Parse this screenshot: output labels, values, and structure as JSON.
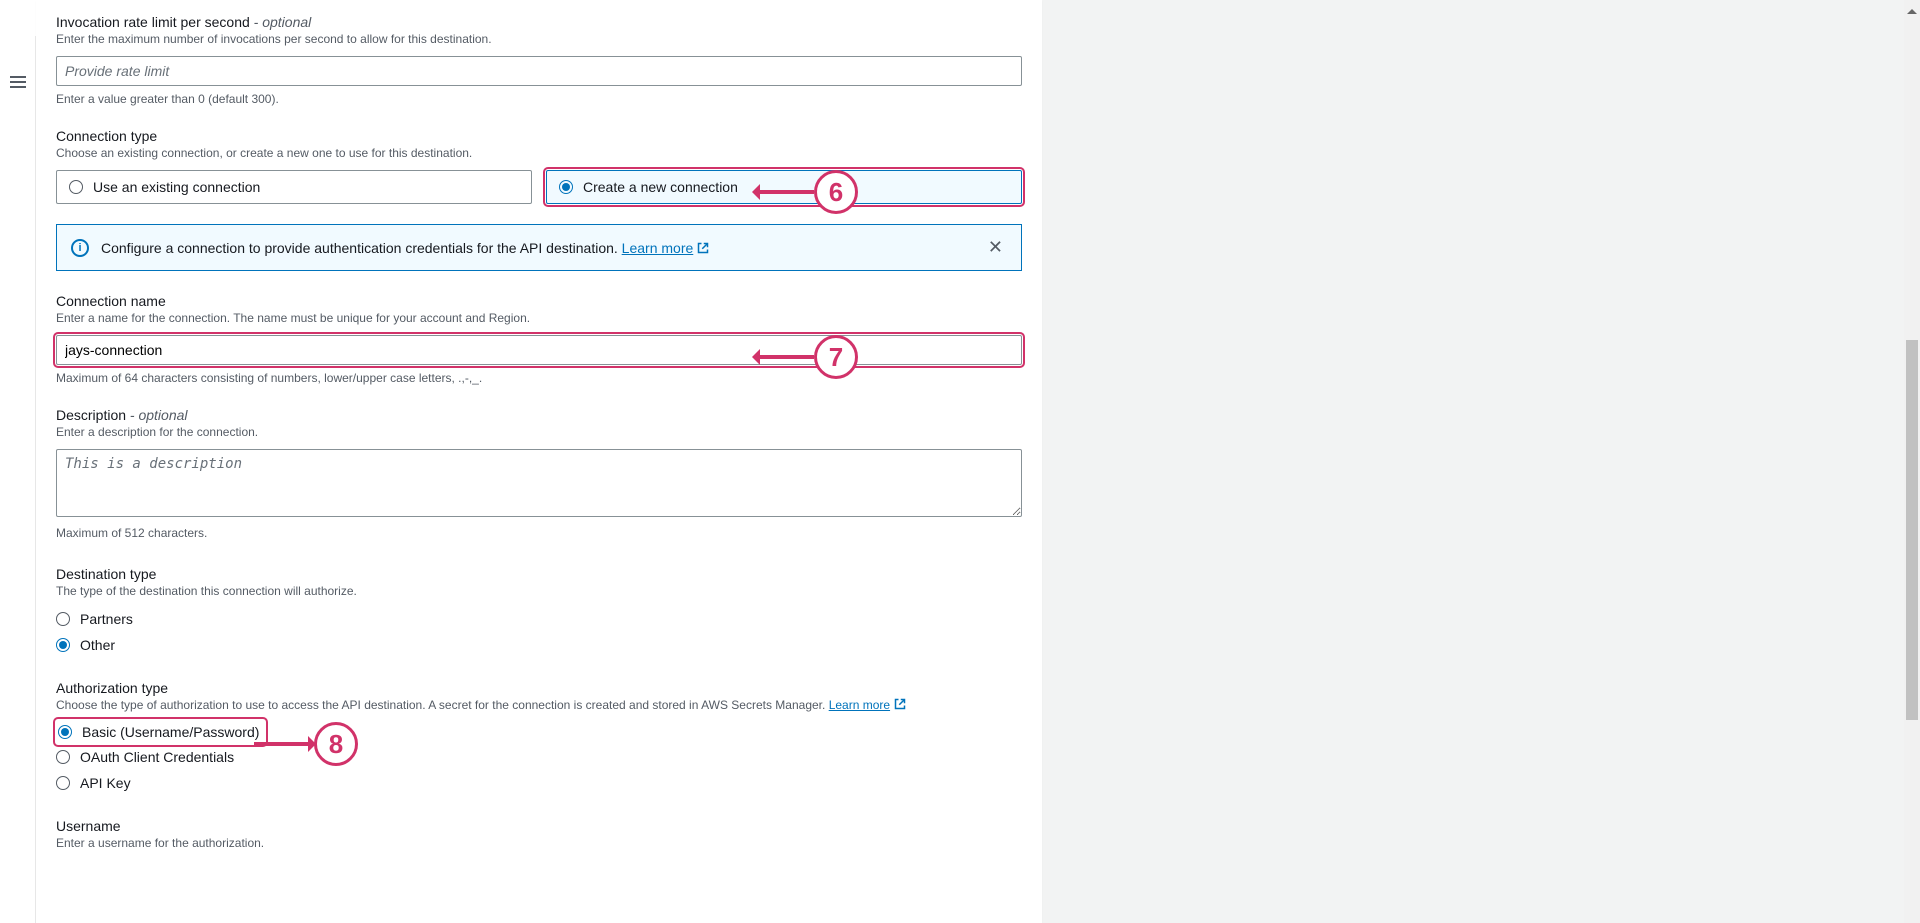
{
  "invocation": {
    "label": "Invocation rate limit per second",
    "optional": " - optional",
    "sub": "Enter the maximum number of invocations per second to allow for this destination.",
    "placeholder": "Provide rate limit",
    "hint": "Enter a value greater than 0 (default 300)."
  },
  "connectionType": {
    "label": "Connection type",
    "sub": "Choose an existing connection, or create a new one to use for this destination.",
    "option_existing": "Use an existing connection",
    "option_new": "Create a new connection"
  },
  "infoBanner": {
    "text": "Configure a connection to provide authentication credentials for the API destination. ",
    "link": "Learn more",
    "icon_letter": "i"
  },
  "connectionName": {
    "label": "Connection name",
    "sub": "Enter a name for the connection. The name must be unique for your account and Region.",
    "value": "jays-connection",
    "hint": "Maximum of 64 characters consisting of numbers, lower/upper case letters, .,-,_."
  },
  "description": {
    "label": "Description",
    "optional": " - optional",
    "sub": "Enter a description for the connection.",
    "placeholder": "This is a description",
    "hint": "Maximum of 512 characters."
  },
  "destinationType": {
    "label": "Destination type",
    "sub": "The type of the destination this connection will authorize.",
    "option_partners": "Partners",
    "option_other": "Other"
  },
  "authType": {
    "label": "Authorization type",
    "sub": "Choose the type of authorization to use to access the API destination. A secret for the connection is created and stored in AWS Secrets Manager. ",
    "learn_more": "Learn more",
    "option_basic": "Basic (Username/Password)",
    "option_oauth": "OAuth Client Credentials",
    "option_apikey": "API Key"
  },
  "username": {
    "label": "Username",
    "sub": "Enter a username for the authorization."
  },
  "annotations": {
    "n6": "6",
    "n7": "7",
    "n8": "8"
  }
}
